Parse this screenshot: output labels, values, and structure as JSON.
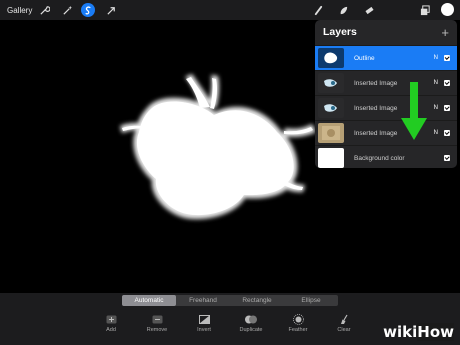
{
  "topbar": {
    "gallery_label": "Gallery",
    "icons": [
      "wrench-icon",
      "magic-wand-icon",
      "selection-icon",
      "transform-arrow-icon",
      "brush-icon",
      "smudge-icon",
      "eraser-icon",
      "layers-icon",
      "color-swatch"
    ],
    "accent": "#1a7cf5"
  },
  "layers": {
    "title": "Layers",
    "add": "+",
    "items": [
      {
        "name": "Outline",
        "mode": "N",
        "active": true
      },
      {
        "name": "Inserted Image",
        "mode": "N",
        "active": false
      },
      {
        "name": "Inserted Image",
        "mode": "N",
        "active": false
      },
      {
        "name": "Inserted Image",
        "mode": "N",
        "active": false
      },
      {
        "name": "Background color",
        "mode": "",
        "active": false
      }
    ]
  },
  "selection_modes": [
    "Automatic",
    "Freehand",
    "Rectangle",
    "Ellipse"
  ],
  "selected_mode": "Automatic",
  "actions": [
    "Add",
    "Remove",
    "Invert",
    "Duplicate",
    "Feather",
    "Clear"
  ],
  "watermark": {
    "part1": "wiki",
    "part2": "How"
  },
  "colors": {
    "arrow": "#22cc22",
    "panel": "#262628"
  }
}
